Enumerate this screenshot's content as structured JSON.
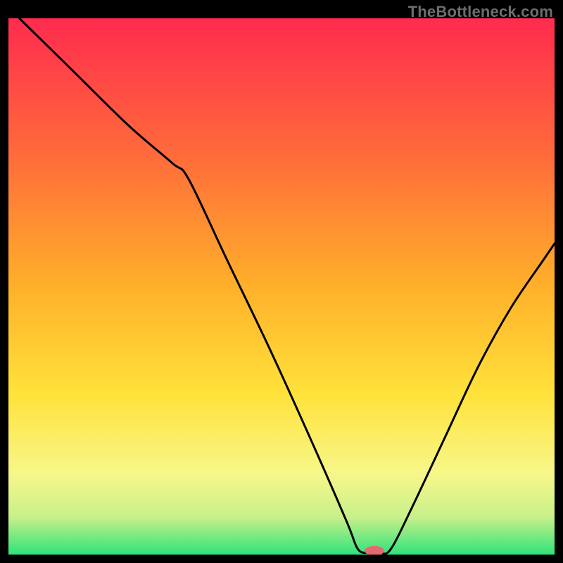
{
  "watermark": "TheBottleneck.com",
  "marker_color": "#e46a6f",
  "chart_data": {
    "type": "line",
    "title": "",
    "xlabel": "",
    "ylabel": "",
    "xlim": [
      0,
      100
    ],
    "ylim": [
      0,
      100
    ],
    "gradient_stops": [
      {
        "offset": 0,
        "color": "#ff2b4e"
      },
      {
        "offset": 25,
        "color": "#ff6a3b"
      },
      {
        "offset": 50,
        "color": "#ffb02a"
      },
      {
        "offset": 70,
        "color": "#ffe23a"
      },
      {
        "offset": 85,
        "color": "#f7f78a"
      },
      {
        "offset": 93,
        "color": "#c8f08a"
      },
      {
        "offset": 100,
        "color": "#2fe37a"
      }
    ],
    "series": [
      {
        "name": "curve",
        "points": [
          {
            "x": 2.0,
            "y": 100.0
          },
          {
            "x": 12.0,
            "y": 90.0
          },
          {
            "x": 22.0,
            "y": 80.0
          },
          {
            "x": 30.0,
            "y": 73.0
          },
          {
            "x": 33.0,
            "y": 70.0
          },
          {
            "x": 40.0,
            "y": 55.0
          },
          {
            "x": 48.0,
            "y": 38.0
          },
          {
            "x": 56.0,
            "y": 20.0
          },
          {
            "x": 62.0,
            "y": 6.0
          },
          {
            "x": 64.0,
            "y": 1.0
          },
          {
            "x": 66.0,
            "y": 0.3
          },
          {
            "x": 68.0,
            "y": 0.3
          },
          {
            "x": 70.0,
            "y": 1.0
          },
          {
            "x": 74.0,
            "y": 9.0
          },
          {
            "x": 80.0,
            "y": 22.0
          },
          {
            "x": 86.0,
            "y": 35.0
          },
          {
            "x": 92.0,
            "y": 46.0
          },
          {
            "x": 98.0,
            "y": 55.0
          },
          {
            "x": 100.0,
            "y": 58.0
          }
        ]
      }
    ],
    "marker": {
      "x": 67.0,
      "y": 0.7,
      "rx": 1.8,
      "ry": 0.9
    }
  }
}
